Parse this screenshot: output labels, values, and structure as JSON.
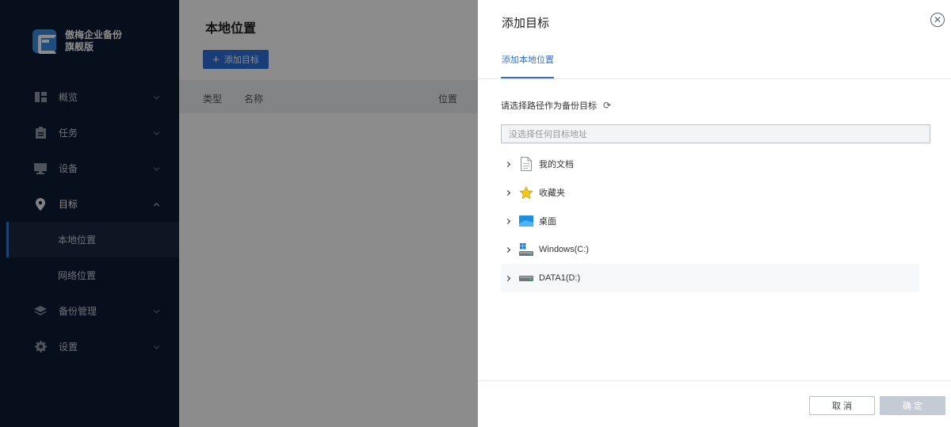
{
  "sidebar": {
    "logo_line1": "傲梅企业备份",
    "logo_line2": "旗舰版",
    "items": [
      {
        "label": "概览"
      },
      {
        "label": "任务"
      },
      {
        "label": "设备"
      },
      {
        "label": "目标"
      },
      {
        "label": "本地位置"
      },
      {
        "label": "网络位置"
      },
      {
        "label": "备份管理"
      },
      {
        "label": "设置"
      }
    ]
  },
  "main": {
    "title": "本地位置",
    "add_button": "添加目标",
    "columns": [
      "类型",
      "名称",
      "位置"
    ]
  },
  "drawer": {
    "title": "添加目标",
    "tab": "添加本地位置",
    "path_label": "请选择路径作为备份目标",
    "path_placeholder": "没选择任何目标地址",
    "tree": [
      {
        "label": "我的文档",
        "icon": "document-icon"
      },
      {
        "label": "收藏夹",
        "icon": "star-icon"
      },
      {
        "label": "桌面",
        "icon": "desktop-icon"
      },
      {
        "label": "Windows(C:)",
        "icon": "windows-drive-icon"
      },
      {
        "label": "DATA1(D:)",
        "icon": "drive-icon"
      }
    ],
    "cancel": "取 消",
    "ok": "确 定"
  },
  "colors": {
    "sidebar_bg": "#0d1a33",
    "accent": "#2f6fd8",
    "disabled": "#c5cbd4"
  }
}
